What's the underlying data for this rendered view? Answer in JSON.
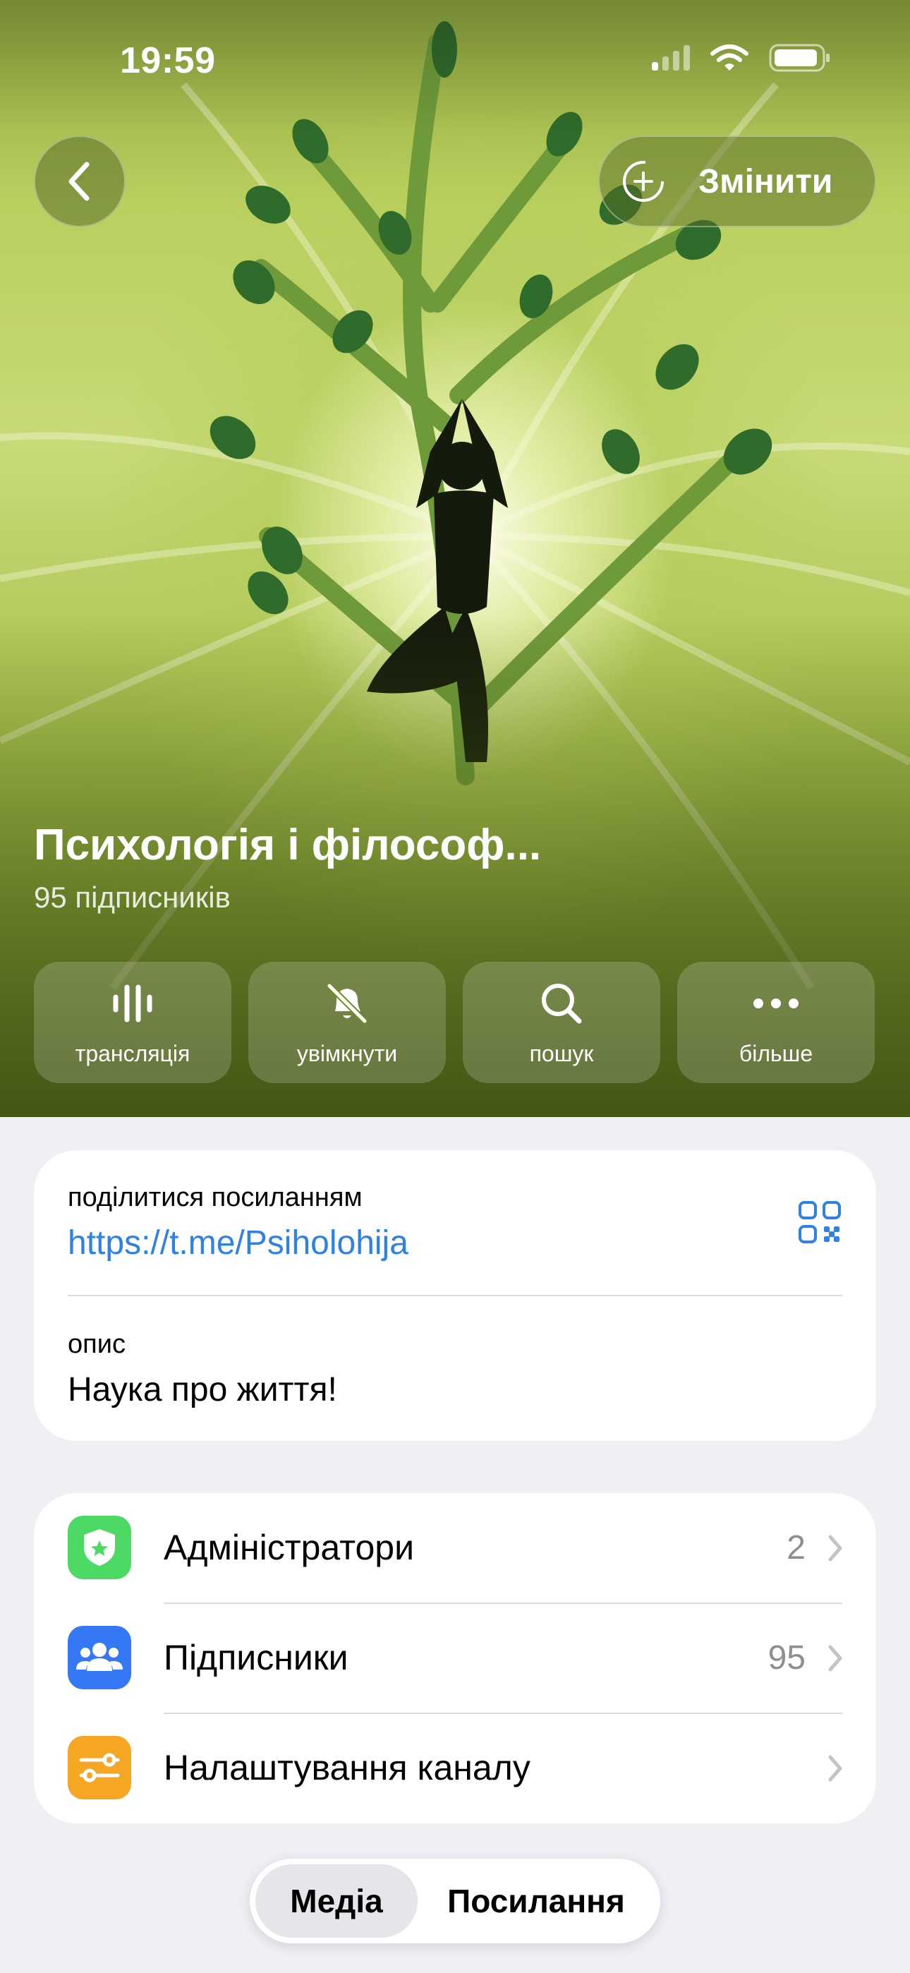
{
  "status_bar": {
    "time": "19:59"
  },
  "header": {
    "back_icon": "chevron-left-icon",
    "edit_label": "Змінити",
    "edit_icon": "add-circle-icon"
  },
  "channel": {
    "title": "Психологія і філософ...",
    "subscribers_text": "95 підписників"
  },
  "actions": [
    {
      "label": "трансляція",
      "icon": "live-stream-icon"
    },
    {
      "label": "увімкнути",
      "icon": "bell-muted-icon"
    },
    {
      "label": "пошук",
      "icon": "search-icon"
    },
    {
      "label": "більше",
      "icon": "more-icon"
    }
  ],
  "info": {
    "share_label": "поділитися посиланням",
    "link": "https://t.me/Psiholohija",
    "description_label": "опис",
    "description": "Наука про життя!"
  },
  "menu": [
    {
      "label": "Адміністратори",
      "value": "2",
      "icon": "shield-star-icon",
      "color": "#4cd964"
    },
    {
      "label": "Підписники",
      "value": "95",
      "icon": "people-icon",
      "color": "#3478f6"
    },
    {
      "label": "Налаштування каналу",
      "value": "",
      "icon": "sliders-icon",
      "color": "#f5a623"
    }
  ],
  "tabs": [
    {
      "label": "Медіа",
      "active": true
    },
    {
      "label": "Посилання",
      "active": false
    }
  ],
  "colors": {
    "link": "#2f81e4",
    "background": "#efeff4",
    "hero_green": "#a9c24f"
  }
}
